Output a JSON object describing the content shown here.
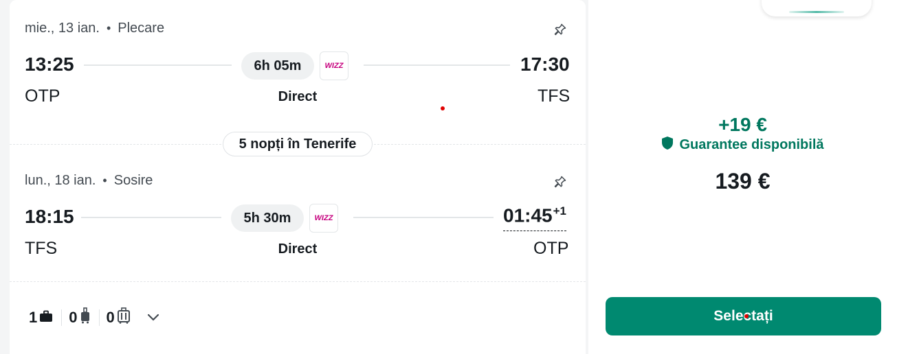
{
  "outbound": {
    "date": "mie., 13 ian.",
    "label": "Plecare",
    "dep_time": "13:25",
    "arr_time": "17:30",
    "duration": "6h 05m",
    "dep_code": "OTP",
    "arr_code": "TFS",
    "stops": "Direct",
    "airline_logo_text": "WIZZ"
  },
  "stay": {
    "label": "5 nopți în Tenerife"
  },
  "inbound": {
    "date": "lun., 18 ian.",
    "label": "Sosire",
    "dep_time": "18:15",
    "arr_time": "01:45",
    "day_offset": "+1",
    "duration": "5h 30m",
    "dep_code": "TFS",
    "arr_code": "OTP",
    "stops": "Direct",
    "airline_logo_text": "WIZZ"
  },
  "baggage": {
    "personal_item_count": "1",
    "carry_on_count": "0",
    "checked_count": "0"
  },
  "pricing": {
    "delta": "+19 €",
    "guarantee": "Guarantee disponibilă",
    "price": "139 €",
    "select_label": "Selectați"
  },
  "colors": {
    "accent": "#008970",
    "accent_text": "#00775e",
    "wizz": "#c6007e"
  },
  "icons": [
    "pin-icon",
    "briefcase-icon",
    "carry-on-icon",
    "checked-bag-icon",
    "chevron-down-icon",
    "shield-icon"
  ]
}
